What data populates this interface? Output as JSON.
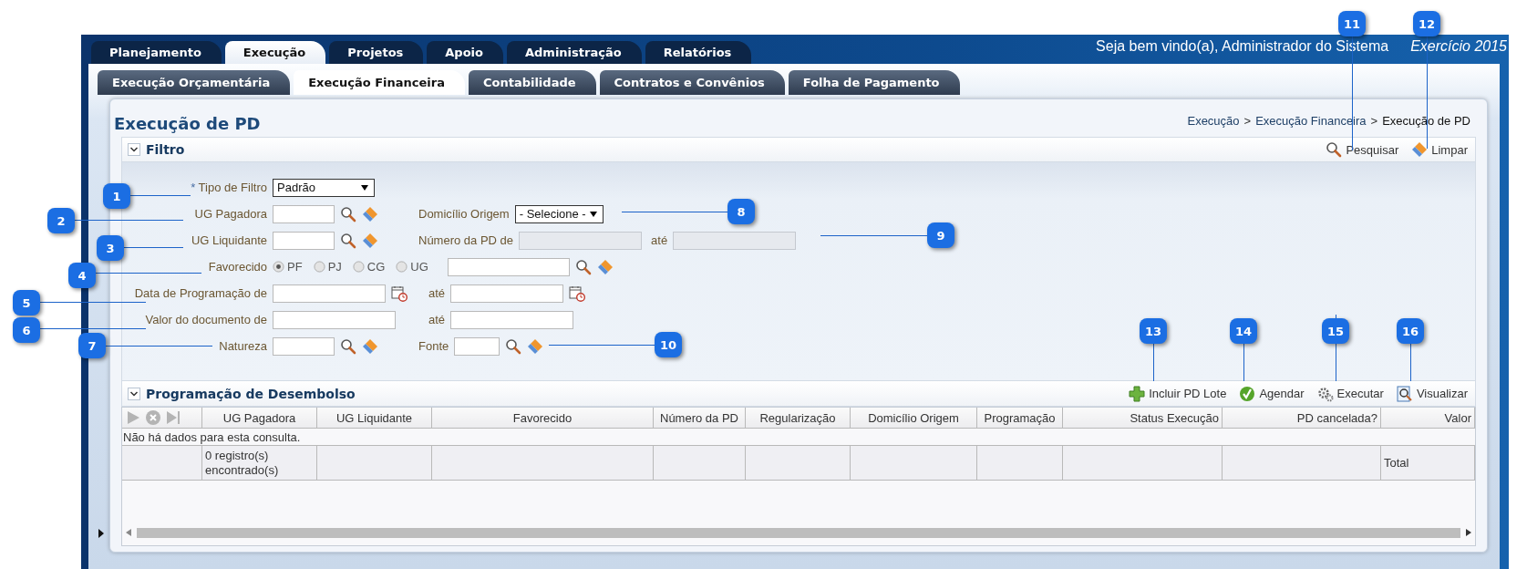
{
  "top_tabs": [
    {
      "label": "Planejamento",
      "selected": false
    },
    {
      "label": "Execução",
      "selected": true
    },
    {
      "label": "Projetos",
      "selected": false
    },
    {
      "label": "Apoio",
      "selected": false
    },
    {
      "label": "Administração",
      "selected": false
    },
    {
      "label": "Relatórios",
      "selected": false
    }
  ],
  "welcome": "Seja bem vindo(a), Administrador do Sistema",
  "exercise": "Exercício 2015",
  "sub_tabs": [
    {
      "label": "Execução Orçamentária",
      "selected": false
    },
    {
      "label": "Execução Financeira",
      "selected": true
    },
    {
      "label": "Contabilidade",
      "selected": false
    },
    {
      "label": "Contratos e Convênios",
      "selected": false
    },
    {
      "label": "Folha de Pagamento",
      "selected": false
    }
  ],
  "page_title": "Execução de PD",
  "breadcrumb": [
    {
      "label": "Execução",
      "current": false
    },
    {
      "label": "Execução Financeira",
      "current": false
    },
    {
      "label": "Execução de PD",
      "current": true
    }
  ],
  "breadcrumb_separator": ">",
  "filter": {
    "title": "Filtro",
    "expanded": true,
    "actions": [
      {
        "label": "Pesquisar",
        "kind": "search"
      },
      {
        "label": "Limpar",
        "kind": "clear"
      }
    ],
    "tipo_filtro": {
      "required_mark": "*",
      "label": "Tipo de Filtro",
      "value": "Padrão"
    },
    "ug_pagadora": {
      "label": "UG Pagadora"
    },
    "domicilio_origem": {
      "label": "Domicílio Origem",
      "value": "- Selecione -"
    },
    "ug_liquidante": {
      "label": "UG Liquidante"
    },
    "numero_pd": {
      "label": "Número da PD de",
      "to_label": "até",
      "disabled": true
    },
    "favorecido": {
      "label": "Favorecido",
      "options": [
        {
          "label": "PF",
          "selected": true
        },
        {
          "label": "PJ",
          "selected": false
        },
        {
          "label": "CG",
          "selected": false
        },
        {
          "label": "UG",
          "selected": false
        }
      ]
    },
    "data_programacao": {
      "label": "Data de Programação de",
      "to_label": "até"
    },
    "valor_documento": {
      "label": "Valor do documento de",
      "to_label": "até"
    },
    "natureza": {
      "label": "Natureza"
    },
    "fonte": {
      "label": "Fonte"
    }
  },
  "grid": {
    "title": "Programação de Desembolso",
    "expanded": true,
    "actions": [
      {
        "label": "Incluir PD Lote",
        "kind": "add"
      },
      {
        "label": "Agendar",
        "kind": "schedule"
      },
      {
        "label": "Executar",
        "kind": "execute"
      },
      {
        "label": "Visualizar",
        "kind": "view"
      }
    ],
    "columns": [
      {
        "label": "UG Pagadora"
      },
      {
        "label": "UG Liquidante"
      },
      {
        "label": "Favorecido"
      },
      {
        "label": "Número da PD"
      },
      {
        "label": "Regularização"
      },
      {
        "label": "Domicílio Origem"
      },
      {
        "label": "Programação"
      },
      {
        "label": "Status Execução"
      },
      {
        "label": "PD cancelada?"
      },
      {
        "label": "Valor"
      }
    ],
    "empty_message": "Não há dados para esta consulta.",
    "record_count": "0 registro(s) encontrado(s)",
    "total_label": "Total"
  },
  "callouts": [
    {
      "label": "1"
    },
    {
      "label": "2"
    },
    {
      "label": "3"
    },
    {
      "label": "4"
    },
    {
      "label": "5"
    },
    {
      "label": "6"
    },
    {
      "label": "7"
    },
    {
      "label": "8"
    },
    {
      "label": "9"
    },
    {
      "label": "10"
    },
    {
      "label": "11"
    },
    {
      "label": "12"
    },
    {
      "label": "13"
    },
    {
      "label": "14"
    },
    {
      "label": "15"
    },
    {
      "label": "16"
    }
  ]
}
